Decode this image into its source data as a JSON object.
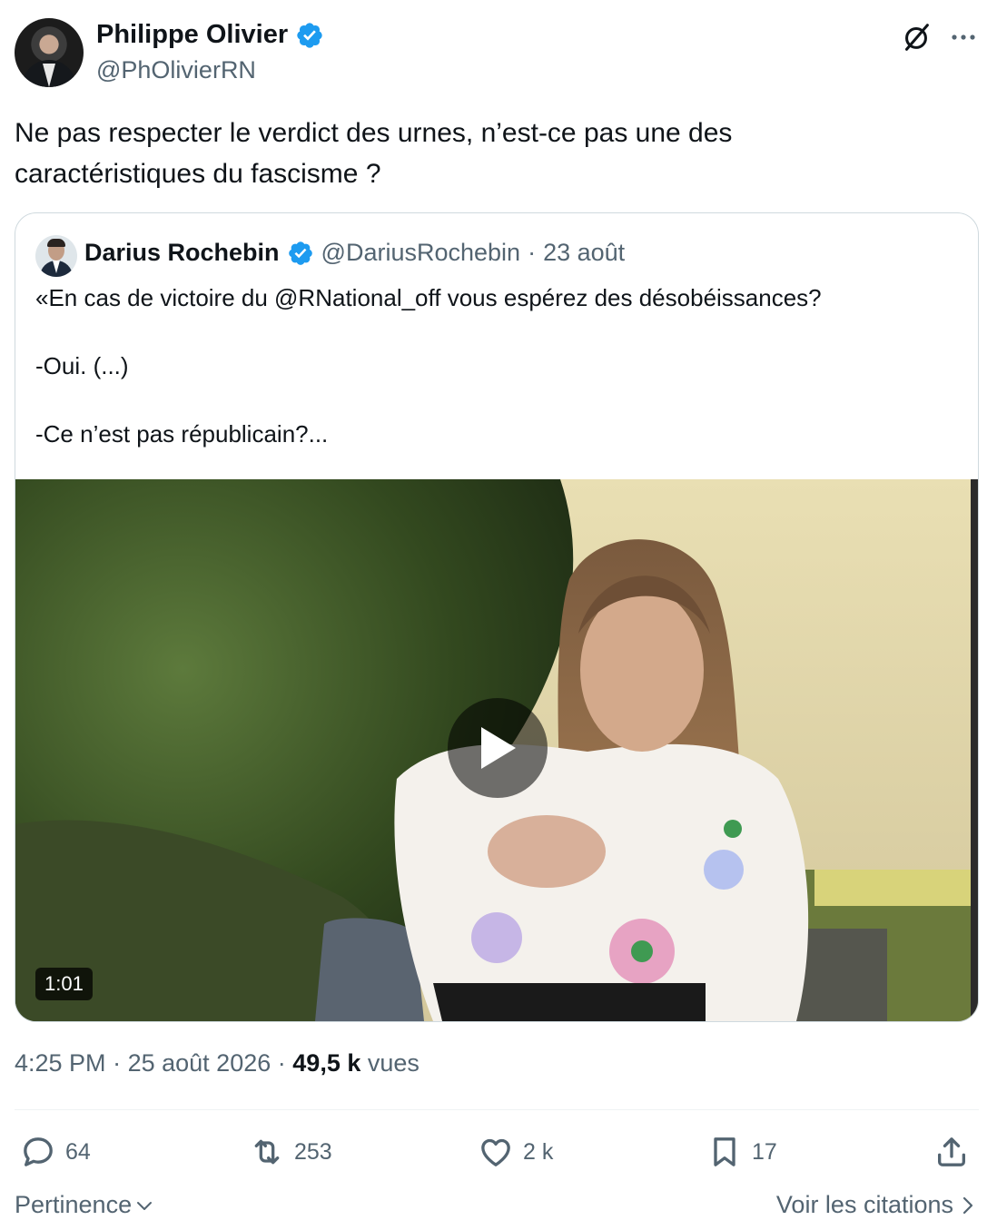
{
  "author": {
    "name": "Philippe Olivier",
    "handle": "@PhOlivierRN"
  },
  "tweet": {
    "text_line1": "Ne pas respecter le verdict des urnes, n’est-ce pas une des",
    "text_line2": "caractéristiques du fascisme ?"
  },
  "quoted": {
    "name": "Darius Rochebin",
    "handle": "@DariusRochebin",
    "separator": "·",
    "date": "23 août",
    "lines": [
      "«En cas de victoire du @RNational_off vous espérez des désobéissances?",
      "-Oui. (...)",
      "-Ce n’est pas républicain?..."
    ],
    "video": {
      "duration": "1:01"
    }
  },
  "meta": {
    "time": "4:25 PM",
    "dot": "·",
    "date": "25 août 2026",
    "dot2": "·",
    "views_count": "49,5 k",
    "views_label": "vues"
  },
  "actions": {
    "replies": "64",
    "reposts": "253",
    "likes": "2 k",
    "bookmarks": "17"
  },
  "footer": {
    "sort_label": "Pertinence",
    "quotes_link": "Voir les citations"
  },
  "colors": {
    "text_primary": "#0f1419",
    "text_secondary": "#536471",
    "verified_blue": "#1d9bf0",
    "border": "#cfd9de"
  },
  "icons": [
    "verified-badge-icon",
    "grok-icon",
    "more-icon",
    "play-icon",
    "reply-icon",
    "repost-icon",
    "like-icon",
    "bookmark-icon",
    "share-icon",
    "chevron-down-icon",
    "chevron-right-icon"
  ]
}
